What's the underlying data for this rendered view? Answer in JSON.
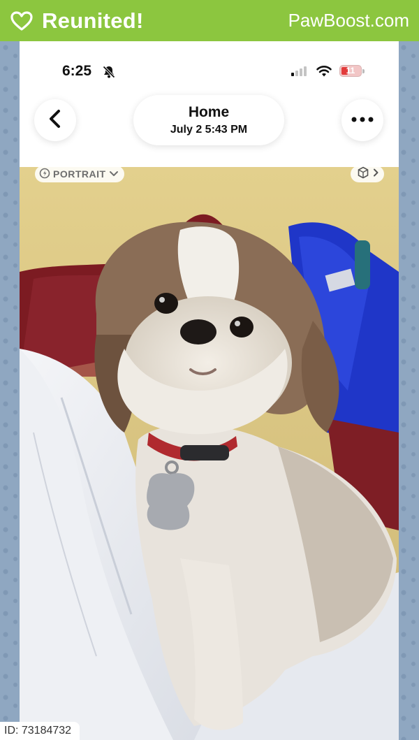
{
  "banner": {
    "title": "Reunited!",
    "brand": "PawBoost.com",
    "color": "#8cc63f"
  },
  "status_bar": {
    "time": "6:25",
    "battery": "11"
  },
  "header": {
    "title": "Home",
    "subtitle": "July 2  5:43 PM"
  },
  "photo": {
    "badge_label": "PORTRAIT"
  },
  "footer": {
    "id_label": "ID: 73184732"
  },
  "icons": {
    "banner": "heart-icon",
    "back": "chevron-left-icon",
    "more": "more-horizontal-icon",
    "silent": "bell-off-icon",
    "signal": "signal-icon",
    "wifi": "wifi-icon",
    "battery": "battery-icon",
    "portrait": "portrait-icon",
    "portrait_chevron": "chevron-down-icon",
    "visual_lookup": "visual-lookup-icon"
  }
}
